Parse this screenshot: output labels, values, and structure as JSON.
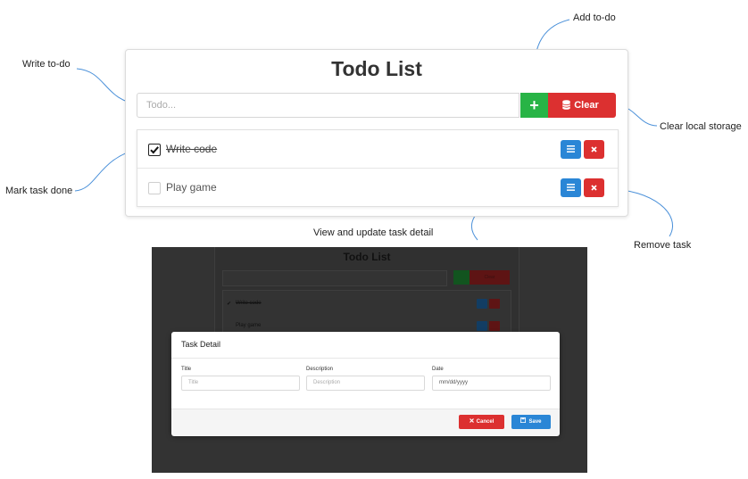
{
  "annotations": {
    "write_todo": "Write to-do",
    "add_todo": "Add to-do",
    "clear_storage": "Clear local storage",
    "mark_done": "Mark task done",
    "view_update": "View and update task detail",
    "remove_task": "Remove task"
  },
  "app": {
    "title": "Todo List",
    "input_placeholder": "Todo...",
    "add_label": "+",
    "clear_label": "Clear",
    "tasks": [
      {
        "label": "Write code",
        "done": true
      },
      {
        "label": "Play game",
        "done": false
      }
    ]
  },
  "modal_screenshot": {
    "background_title": "Todo List",
    "background_clear_label": "Clear",
    "background_tasks": [
      "Write code",
      "Play game"
    ],
    "modal_title": "Task Detail",
    "fields": [
      {
        "label": "Title",
        "placeholder": "Title"
      },
      {
        "label": "Description",
        "placeholder": "Description"
      },
      {
        "label": "Date",
        "placeholder": "mm/dd/yyyy"
      }
    ],
    "cancel_label": "Cancel",
    "save_label": "Save"
  },
  "colors": {
    "green": "#28b446",
    "red": "#dc3030",
    "blue": "#2a86d6",
    "arrow": "#4a90d9",
    "overlay": "#333333"
  },
  "icons": [
    "database-icon",
    "list-icon",
    "times-icon",
    "check-icon",
    "save-icon"
  ]
}
